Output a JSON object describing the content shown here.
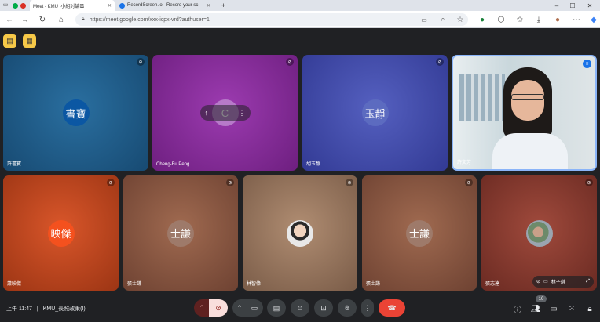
{
  "browser": {
    "tabs": [
      {
        "label": "Meet - KMU_小組討論區",
        "active": true
      },
      {
        "label": "RecordScreen.io - Record your sc",
        "active": false
      }
    ],
    "new_tab": "+",
    "url": "https://meet.google.com/xxx-icpx-vrd?authuser=1"
  },
  "meet": {
    "participants": [
      {
        "initials": "書寶",
        "name": "許書寶",
        "color": "#0b57a3",
        "bg": "#1d5b8a"
      },
      {
        "initials": "C",
        "name": "Cheng-Fu Peng",
        "color": "#8e4fa0",
        "bg": "#7a2a8e"
      },
      {
        "initials": "玉靜",
        "name": "胡玉靜",
        "color": "#5c6bc0",
        "bg": "#3f47a0"
      },
      {
        "initials": "",
        "name": "許文芳",
        "color": "",
        "bg": "#c9d2d6"
      },
      {
        "initials": "映傑",
        "name": "蕭映傑",
        "color": "#e65100",
        "bg": "#c2451c"
      },
      {
        "initials": "士謙",
        "name": "張士謙",
        "color": "#8d6e63",
        "bg": "#8a5a43"
      },
      {
        "initials": "",
        "name": "林智偉",
        "color": "",
        "bg": "#9a7a63"
      },
      {
        "initials": "士謙",
        "name": "張士謙",
        "color": "#8d6e63",
        "bg": "#8a5a43"
      },
      {
        "initials": "",
        "name": "張志達",
        "color": "",
        "bg": "#8e4a3e"
      }
    ],
    "self_view_name": "林子琪",
    "pin_icon": "↑"
  },
  "bottom": {
    "clock": "上午 11:47",
    "separator": "|",
    "meeting_name": "KMU_長照政策(I)",
    "participant_count": "10"
  }
}
